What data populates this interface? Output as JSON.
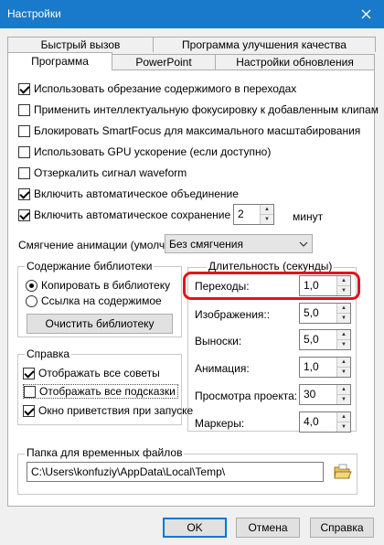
{
  "window": {
    "title": "Настройки"
  },
  "tabs_row1": [
    {
      "label": "Быстрый вызов"
    },
    {
      "label": "Программа улучшения качества"
    }
  ],
  "tabs_row2": [
    {
      "label": "Программа"
    },
    {
      "label": "PowerPoint"
    },
    {
      "label": "Настройки обновления"
    }
  ],
  "options": {
    "crop": {
      "label": "Использовать обрезание содержимого в переходах",
      "checked": true
    },
    "smart_focus": {
      "label": "Применить интеллектуальную фокусировку к добавленным клипам",
      "checked": false
    },
    "block_smartfocus": {
      "label": "Блокировать SmartFocus для максимального масштабирования",
      "checked": false
    },
    "gpu": {
      "label": "Использовать GPU ускорение (если доступно)",
      "checked": false
    },
    "mirror_waveform": {
      "label": "Отзеркалить сигнал waveform",
      "checked": false
    },
    "auto_merge": {
      "label": "Включить автоматическое объединение",
      "checked": true
    },
    "auto_save": {
      "label": "Включить автоматическое сохранение",
      "checked": true,
      "value": "2",
      "unit": "минут"
    }
  },
  "animation_smoothing": {
    "label": "Смягчение анимации (умолч):",
    "value": "Без смягчения"
  },
  "library": {
    "title": "Содержание библиотеки",
    "copy_label": "Копировать в библиотеку",
    "link_label": "Ссылка на содержимое",
    "clear_button": "Очистить библиотеку"
  },
  "help": {
    "title": "Справка",
    "tips": {
      "label": "Отображать все советы",
      "checked": true
    },
    "hints": {
      "label": "Отображать все подсказки",
      "checked": false
    },
    "welcome": {
      "label": "Окно приветствия при запуске",
      "checked": true
    }
  },
  "duration": {
    "title": "Длительность (секунды)",
    "transitions": {
      "label": "Переходы:",
      "value": "1,0"
    },
    "images": {
      "label": "Изображения::",
      "value": "5,0"
    },
    "callouts": {
      "label": "Выноски:",
      "value": "5,0"
    },
    "animation": {
      "label": "Анимация:",
      "value": "1,0"
    },
    "preview": {
      "label": "Просмотра проекта:",
      "value": "30"
    },
    "markers": {
      "label": "Маркеры:",
      "value": "4,0"
    }
  },
  "temp_folder": {
    "title": "Папка для временных файлов",
    "path": "C:\\Users\\konfuziy\\AppData\\Local\\Temp\\"
  },
  "buttons": {
    "ok": "OK",
    "cancel": "Отмена",
    "help": "Справка"
  },
  "colors": {
    "titlebar": "#1979ca",
    "highlight": "#e0141e",
    "default_button_border": "#0078d7"
  }
}
